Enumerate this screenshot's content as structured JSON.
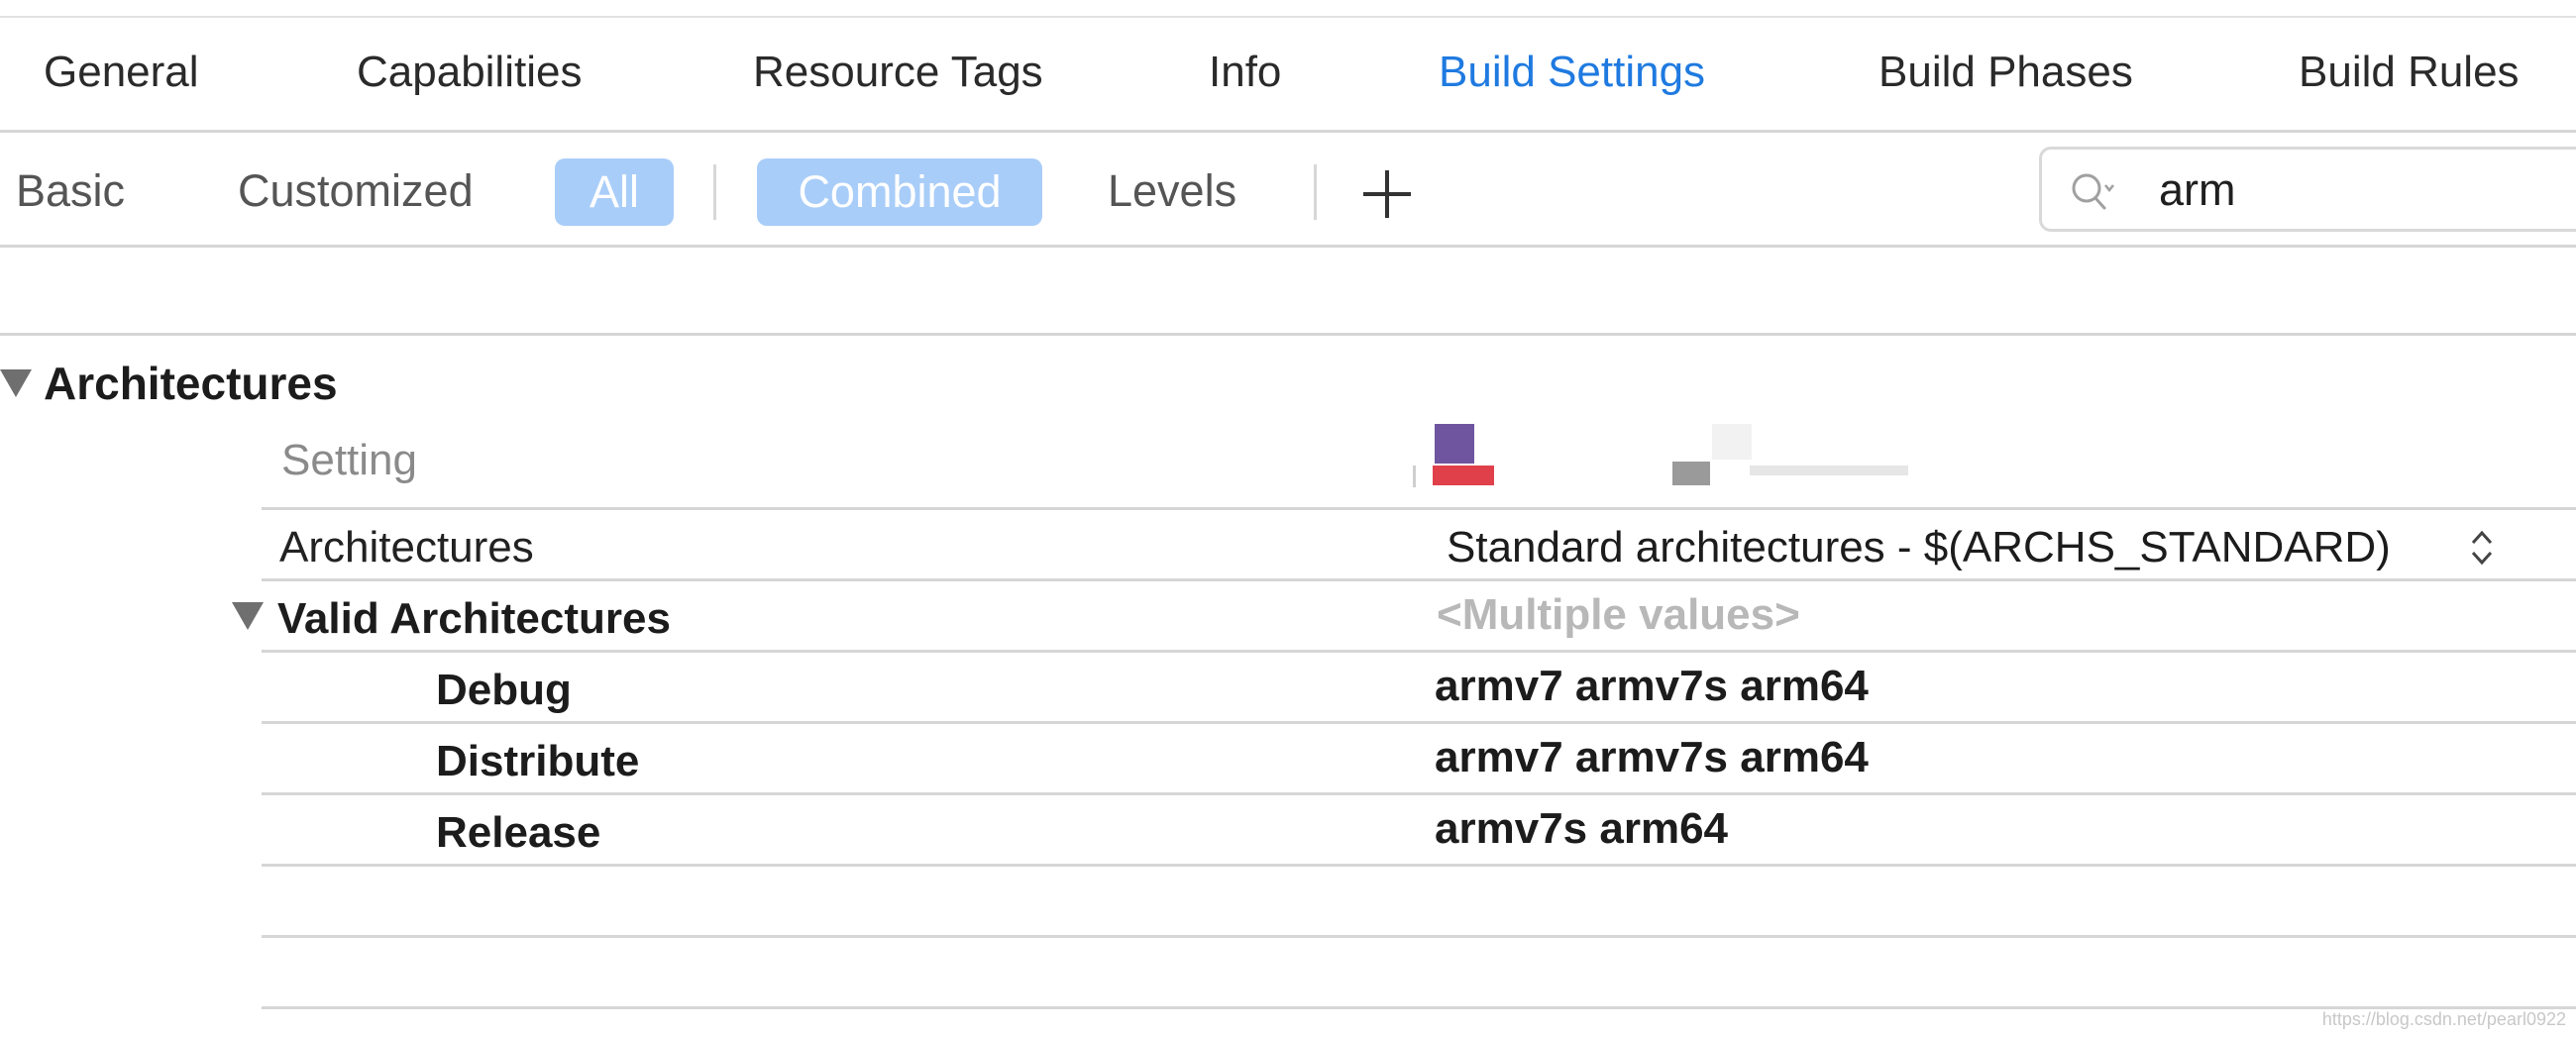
{
  "tabs": [
    {
      "label": "General",
      "active": false
    },
    {
      "label": "Capabilities",
      "active": false
    },
    {
      "label": "Resource Tags",
      "active": false
    },
    {
      "label": "Info",
      "active": false
    },
    {
      "label": "Build Settings",
      "active": true
    },
    {
      "label": "Build Phases",
      "active": false
    },
    {
      "label": "Build Rules",
      "active": false
    }
  ],
  "filters": {
    "basic": "Basic",
    "customized": "Customized",
    "all": "All",
    "combined": "Combined",
    "levels": "Levels"
  },
  "search": {
    "value": "arm",
    "icon": "search-icon"
  },
  "section": {
    "title": "Architectures"
  },
  "table": {
    "setting_header": "Setting",
    "rows": [
      {
        "name": "Architectures",
        "value": "Standard architectures  -  $(ARCHS_STANDARD)"
      },
      {
        "name": "Valid Architectures",
        "value": "<Multiple values>"
      },
      {
        "name": "Debug",
        "value": "armv7 armv7s arm64"
      },
      {
        "name": "Distribute",
        "value": "armv7 armv7s arm64"
      },
      {
        "name": "Release",
        "value": "armv7s arm64"
      }
    ]
  },
  "watermark": "https://blog.csdn.net/pearl0922",
  "colors": {
    "accent": "#1f7ae0",
    "pill": "#a9cdf9",
    "separator": "#d6d6d6"
  }
}
